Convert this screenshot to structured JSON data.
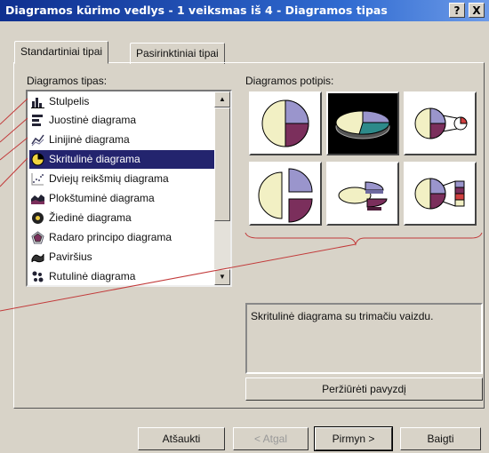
{
  "window": {
    "title": "Diagramos kūrimo vedlys - 1 veiksmas iš 4 - Diagramos tipas",
    "help_label": "?",
    "close_label": "X"
  },
  "tabs": [
    {
      "label": "Standartiniai tipai"
    },
    {
      "label": "Pasirinktiniai tipai"
    }
  ],
  "chart_types": {
    "label": "Diagramos tipas:",
    "items": [
      {
        "label": "Stulpelis",
        "icon": "column-chart-icon"
      },
      {
        "label": "Juostinė diagrama",
        "icon": "bar-chart-icon"
      },
      {
        "label": "Linijinė diagrama",
        "icon": "line-chart-icon"
      },
      {
        "label": "Skritulinė diagrama",
        "icon": "pie-chart-icon",
        "selected": true
      },
      {
        "label": "Dviejų reikšmių diagrama",
        "icon": "scatter-chart-icon"
      },
      {
        "label": "Plokštuminė diagrama",
        "icon": "area-chart-icon"
      },
      {
        "label": "Žiedinė diagrama",
        "icon": "doughnut-chart-icon"
      },
      {
        "label": "Radaro principo diagrama",
        "icon": "radar-chart-icon"
      },
      {
        "label": "Paviršius",
        "icon": "surface-chart-icon"
      },
      {
        "label": "Rutulinė diagrama",
        "icon": "bubble-chart-icon"
      }
    ]
  },
  "subtypes": {
    "label": "Diagramos potipis:",
    "description": "Skritulinė diagrama su trimačiu vaizdu."
  },
  "preview_button": "Peržiūrėti pavyzdį",
  "buttons": {
    "cancel": "Atšaukti",
    "back": "< Atgal",
    "next": "Pirmyn >",
    "finish": "Baigti"
  },
  "colors": {
    "pie_blue": "#9a95cc",
    "pie_purple": "#7b2f5c",
    "pie_cream": "#f2f0c4",
    "pie_teal": "#2d8a8a",
    "annotation_red": "#c23a3a"
  }
}
